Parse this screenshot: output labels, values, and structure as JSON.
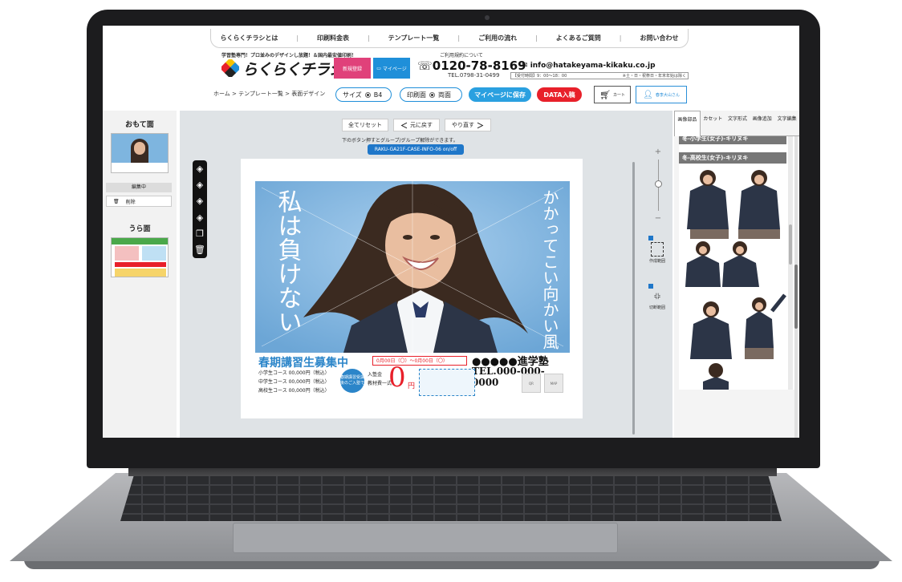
{
  "nav": {
    "items": [
      "らくらくチラシとは",
      "印刷料金表",
      "テンプレート一覧",
      "ご利用の流れ",
      "よくあるご質問",
      "お問い合わせ"
    ]
  },
  "header": {
    "tagline": "学習塾専門！プロ並みのデザインし放題！＆国内最安値印刷！",
    "logo": "らくらくチラシ",
    "register_label": "新規登録",
    "mypage_label": "マイページ",
    "tel_note": "ご利用規約について",
    "tel": "0120-78-8169",
    "tel_sub": "TEL.0798-31-0499",
    "email": "info@hatakeyama-kikaku.co.jp",
    "hours": "【受付時間】9：00～18：00",
    "holidays": "※土・日・祝祭日・年末年始は除く"
  },
  "toolbar": {
    "breadcrumb": "ホーム > テンプレート一覧 > 表面デザイン",
    "size_label": "サイズ",
    "size_value": "B4",
    "print_label": "印刷面",
    "print_value": "両面",
    "save_label": "マイページに保存",
    "data_label": "DATA入稿",
    "cart_label": "カート",
    "user_label": "春李大山さん"
  },
  "left": {
    "front_title": "おもて面",
    "editing_label": "編集中",
    "delete_label": "削除",
    "back_title": "うら面"
  },
  "canvas": {
    "reset_label": "全てリセット",
    "undo_label": "元に戻す",
    "redo_label": "やり直す",
    "hint": "下のボタン押すとグループ/グループ解除ができます。",
    "group_id": "RAKU-GA21F-CASE-INFO-06 on/off",
    "opt_create": "作成範囲",
    "opt_cut": "切断範囲"
  },
  "flyer": {
    "headline": "私は負けない",
    "subline": "かかってこい向かい風",
    "title": "春期講習生募集中",
    "dates": "0月00日（〇）～0月00日（〇）",
    "school": "●●●●●進学塾",
    "tel": "TEL.000-000-0000",
    "course_1": "小学生コース 00,000円（税込）",
    "course_2": "中学生コース 00,000円（税込）",
    "course_3": "高校生コース 00,000円（税込）",
    "circle": "春期講習受講後のご入塾で",
    "fee_1": "入塾金",
    "fee_2": "教材費一式",
    "price": "0",
    "yen": "円",
    "qr": "QR",
    "map": "MAP"
  },
  "right": {
    "tabs": [
      "画像部品",
      "カセット",
      "文字形式",
      "画像追加",
      "文字編集"
    ],
    "head_1": "冬-小学生(女子)-キリヌキ",
    "head_2": "冬-高校生(女子)-キリヌキ"
  },
  "colors": {
    "accent_blue": "#2aa0e0",
    "accent_red": "#e8202a",
    "flyer_blue": "#2b85c9",
    "photo_sky": "#7eb5df"
  }
}
